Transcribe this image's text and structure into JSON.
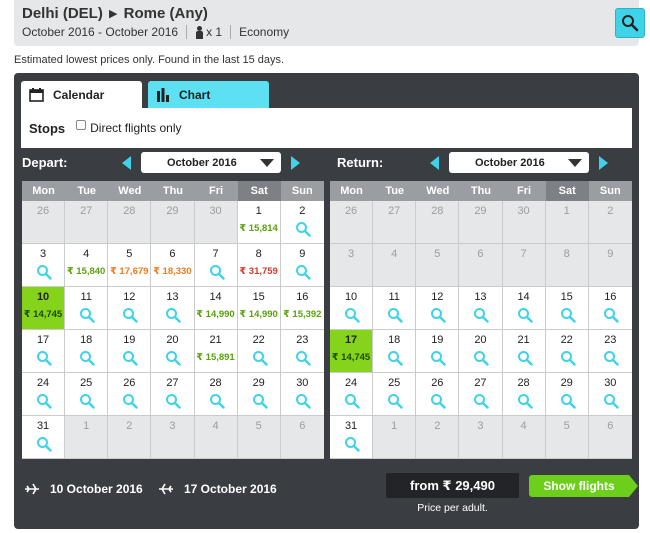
{
  "header": {
    "origin": "Delhi (DEL)",
    "destination": "Rome (Any)",
    "dates": "October 2016 - October 2016",
    "passengers": "x 1",
    "cabin": "Economy"
  },
  "note": "Estimated lowest prices only. Found in the last 15 days.",
  "tabs": {
    "calendar": "Calendar",
    "chart": "Chart"
  },
  "stops": {
    "label": "Stops",
    "direct_label": "Direct flights only",
    "direct_checked": false
  },
  "weekdays": [
    "Mon",
    "Tue",
    "Wed",
    "Thu",
    "Fri",
    "Sat",
    "Sun"
  ],
  "depart": {
    "label": "Depart:",
    "month": "October 2016",
    "cells": [
      {
        "d": "26",
        "o": true
      },
      {
        "d": "27",
        "o": true
      },
      {
        "d": "28",
        "o": true
      },
      {
        "d": "29",
        "o": true
      },
      {
        "d": "30",
        "o": true
      },
      {
        "d": "1",
        "p": "₹ 15,814",
        "c": "green"
      },
      {
        "d": "2",
        "s": true
      },
      {
        "d": "3",
        "s": true
      },
      {
        "d": "4",
        "p": "₹ 15,840",
        "c": "green"
      },
      {
        "d": "5",
        "p": "₹ 17,679",
        "c": "orange"
      },
      {
        "d": "6",
        "p": "₹ 18,330",
        "c": "orange"
      },
      {
        "d": "7",
        "s": true
      },
      {
        "d": "8",
        "p": "₹ 31,759",
        "c": "red"
      },
      {
        "d": "9",
        "s": true
      },
      {
        "d": "10",
        "p": "₹ 14,745",
        "c": "green",
        "sel": true
      },
      {
        "d": "11",
        "s": true
      },
      {
        "d": "12",
        "s": true
      },
      {
        "d": "13",
        "s": true
      },
      {
        "d": "14",
        "p": "₹ 14,990",
        "c": "green"
      },
      {
        "d": "15",
        "p": "₹ 14,990",
        "c": "green"
      },
      {
        "d": "16",
        "p": "₹ 15,392",
        "c": "green"
      },
      {
        "d": "17",
        "s": true
      },
      {
        "d": "18",
        "s": true
      },
      {
        "d": "19",
        "s": true
      },
      {
        "d": "20",
        "s": true
      },
      {
        "d": "21",
        "p": "₹ 15,891",
        "c": "green"
      },
      {
        "d": "22",
        "s": true
      },
      {
        "d": "23",
        "s": true
      },
      {
        "d": "24",
        "s": true
      },
      {
        "d": "25",
        "s": true
      },
      {
        "d": "26",
        "s": true
      },
      {
        "d": "27",
        "s": true
      },
      {
        "d": "28",
        "s": true
      },
      {
        "d": "29",
        "s": true
      },
      {
        "d": "30",
        "s": true
      },
      {
        "d": "31",
        "s": true
      },
      {
        "d": "1",
        "o": true
      },
      {
        "d": "2",
        "o": true
      },
      {
        "d": "3",
        "o": true
      },
      {
        "d": "4",
        "o": true
      },
      {
        "d": "5",
        "o": true
      },
      {
        "d": "6",
        "o": true
      }
    ]
  },
  "return": {
    "label": "Return:",
    "month": "October 2016",
    "cells": [
      {
        "d": "26",
        "o": true
      },
      {
        "d": "27",
        "o": true
      },
      {
        "d": "28",
        "o": true
      },
      {
        "d": "29",
        "o": true
      },
      {
        "d": "30",
        "o": true
      },
      {
        "d": "1",
        "o": true
      },
      {
        "d": "2",
        "o": true
      },
      {
        "d": "3",
        "o": true
      },
      {
        "d": "4",
        "o": true
      },
      {
        "d": "5",
        "o": true
      },
      {
        "d": "6",
        "o": true
      },
      {
        "d": "7",
        "o": true
      },
      {
        "d": "8",
        "o": true
      },
      {
        "d": "9",
        "o": true
      },
      {
        "d": "10",
        "s": true
      },
      {
        "d": "11",
        "s": true
      },
      {
        "d": "12",
        "s": true
      },
      {
        "d": "13",
        "s": true
      },
      {
        "d": "14",
        "s": true
      },
      {
        "d": "15",
        "s": true
      },
      {
        "d": "16",
        "s": true
      },
      {
        "d": "17",
        "p": "₹ 14,745",
        "c": "green",
        "sel": true
      },
      {
        "d": "18",
        "s": true
      },
      {
        "d": "19",
        "s": true
      },
      {
        "d": "20",
        "s": true
      },
      {
        "d": "21",
        "s": true
      },
      {
        "d": "22",
        "s": true
      },
      {
        "d": "23",
        "s": true
      },
      {
        "d": "24",
        "s": true
      },
      {
        "d": "25",
        "s": true
      },
      {
        "d": "26",
        "s": true
      },
      {
        "d": "27",
        "s": true
      },
      {
        "d": "28",
        "s": true
      },
      {
        "d": "29",
        "s": true
      },
      {
        "d": "30",
        "s": true
      },
      {
        "d": "31",
        "s": true
      },
      {
        "d": "1",
        "o": true
      },
      {
        "d": "2",
        "o": true
      },
      {
        "d": "3",
        "o": true
      },
      {
        "d": "4",
        "o": true
      },
      {
        "d": "5",
        "o": true
      },
      {
        "d": "6",
        "o": true
      }
    ]
  },
  "footer": {
    "depart_date": "10 October 2016",
    "return_date": "17 October 2016",
    "price": "from ₹ 29,490",
    "price_note": "Price per adult.",
    "show_flights": "Show flights"
  },
  "colors": {
    "accent": "#3fd3e9",
    "selected": "#86d31c",
    "price_green": "#5aa10c",
    "price_orange": "#f07a1c",
    "price_red": "#d43a2a",
    "button_green": "#6ccf1c"
  }
}
